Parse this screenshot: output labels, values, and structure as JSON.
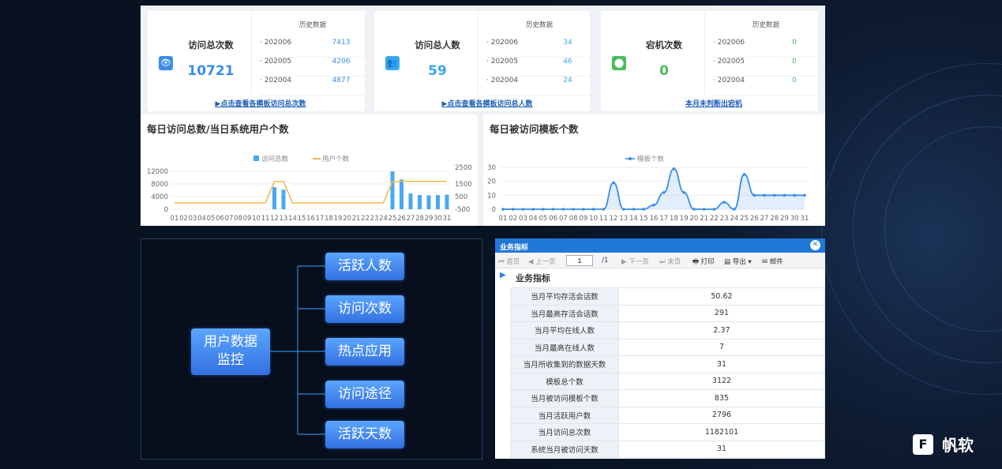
{
  "cards": [
    {
      "title": "访问总次数",
      "big": "10721",
      "hist_title": "历史数据",
      "rows": [
        {
          "period": "· 202006",
          "value": "7413"
        },
        {
          "period": "· 202005",
          "value": "4206"
        },
        {
          "period": "· 202004",
          "value": "4877"
        }
      ],
      "link": "▶点击查看各模板访问总次数",
      "color": "#3a8ee6",
      "icon": "eye-icon"
    },
    {
      "title": "访问总人数",
      "big": "59",
      "hist_title": "历史数据",
      "rows": [
        {
          "period": "· 202006",
          "value": "34"
        },
        {
          "period": "· 202005",
          "value": "46"
        },
        {
          "period": "· 202004",
          "value": "24"
        }
      ],
      "link": "▶点击查看各模板访问总人数",
      "color": "#3aa9ea",
      "icon": "users-icon"
    },
    {
      "title": "宕机次数",
      "big": "0",
      "hist_title": "历史数据",
      "rows": [
        {
          "period": "· 202006",
          "value": "0"
        },
        {
          "period": "· 202005",
          "value": "0"
        },
        {
          "period": "· 202004",
          "value": "0"
        }
      ],
      "link": "本月未判断出宕机",
      "color": "#4cbb5a",
      "icon": "location-icon"
    }
  ],
  "chart1": {
    "title": "每日访问总数/当日系统用户个数"
  },
  "chart2": {
    "title": "每日被访问模板个数"
  },
  "chart_data": [
    {
      "type": "bar",
      "title": "每日访问总数/当日系统用户个数",
      "legend": [
        "访问总数",
        "用户个数"
      ],
      "categories": [
        "01",
        "02",
        "03",
        "04",
        "05",
        "06",
        "07",
        "08",
        "09",
        "10",
        "11",
        "12",
        "13",
        "14",
        "15",
        "16",
        "17",
        "18",
        "19",
        "20",
        "21",
        "22",
        "23",
        "24",
        "25",
        "26",
        "27",
        "28",
        "29",
        "30",
        "31"
      ],
      "y_ticks_left": [
        "12000",
        "8000",
        "4000",
        "0"
      ],
      "y_ticks_right": [
        "2500",
        "1500",
        "500",
        "-500"
      ],
      "ylim_left": [
        0,
        12000
      ],
      "ylim_right": [
        -500,
        2500
      ],
      "series": [
        {
          "name": "访问总数",
          "type": "bar",
          "axis": "left",
          "values": [
            0,
            0,
            0,
            0,
            0,
            0,
            0,
            0,
            0,
            0,
            0,
            7000,
            6200,
            0,
            0,
            0,
            0,
            0,
            0,
            0,
            0,
            0,
            0,
            0,
            12000,
            9400,
            5000,
            4500,
            4400,
            4500,
            4600
          ]
        },
        {
          "name": "用户个数",
          "type": "line",
          "axis": "right",
          "values": [
            0,
            0,
            0,
            0,
            0,
            0,
            0,
            0,
            0,
            0,
            0,
            1700,
            1700,
            0,
            0,
            0,
            0,
            0,
            0,
            0,
            0,
            0,
            0,
            0,
            1700,
            1700,
            1700,
            1700,
            1700,
            1700,
            1700
          ]
        }
      ],
      "colors": {
        "bar": "#4aa8f0",
        "line": "#f5b74a"
      },
      "legend_position": "top-center"
    },
    {
      "type": "area",
      "title": "每日被访问模板个数",
      "legend": [
        "模板个数"
      ],
      "categories": [
        "01",
        "02",
        "03",
        "04",
        "05",
        "06",
        "07",
        "08",
        "09",
        "10",
        "11",
        "12",
        "13",
        "14",
        "15",
        "16",
        "17",
        "18",
        "19",
        "20",
        "21",
        "22",
        "23",
        "24",
        "25",
        "26",
        "27",
        "28",
        "29",
        "30",
        "31"
      ],
      "y_ticks": [
        "30",
        "20",
        "10",
        "0"
      ],
      "ylim": [
        0,
        30
      ],
      "series": [
        {
          "name": "模板个数",
          "values": [
            0,
            0,
            0,
            0,
            0,
            0,
            0,
            0,
            0,
            0,
            0,
            19,
            0,
            0,
            0,
            3,
            12,
            29,
            12,
            0,
            0,
            0,
            5,
            0,
            25,
            10,
            10,
            10,
            10,
            10,
            10
          ]
        }
      ],
      "colors": {
        "line": "#3a8ee6"
      },
      "legend_position": "top-center"
    }
  ],
  "mindmap": {
    "center": "用户数据\n监控",
    "center_line1": "用户数据",
    "center_line2": "监控",
    "branches": [
      "活跃人数",
      "访问次数",
      "热点应用",
      "访问途径",
      "活跃天数"
    ]
  },
  "report": {
    "window_title": "业务指标",
    "toolbar": {
      "first": "首页",
      "prev": "上一页",
      "page_value": "1",
      "page_total": "/1",
      "next": "下一页",
      "last": "末页",
      "print": "打印",
      "export": "导出",
      "mail": "邮件"
    },
    "section": "业务指标",
    "rows": [
      {
        "k": "当月平均存活会话数",
        "v": "50.62"
      },
      {
        "k": "当月最高存活会话数",
        "v": "291"
      },
      {
        "k": "当月平均在线人数",
        "v": "2.37"
      },
      {
        "k": "当月最高在线人数",
        "v": "7"
      },
      {
        "k": "当月所收集到的数据天数",
        "v": "31"
      },
      {
        "k": "模板总个数",
        "v": "3122"
      },
      {
        "k": "当月被访问模板个数",
        "v": "835"
      },
      {
        "k": "当月活跃用户数",
        "v": "2796"
      },
      {
        "k": "当月访问总次数",
        "v": "1182101"
      },
      {
        "k": "系统当月被访问天数",
        "v": "31"
      }
    ]
  },
  "brand": {
    "name": "帆软"
  }
}
